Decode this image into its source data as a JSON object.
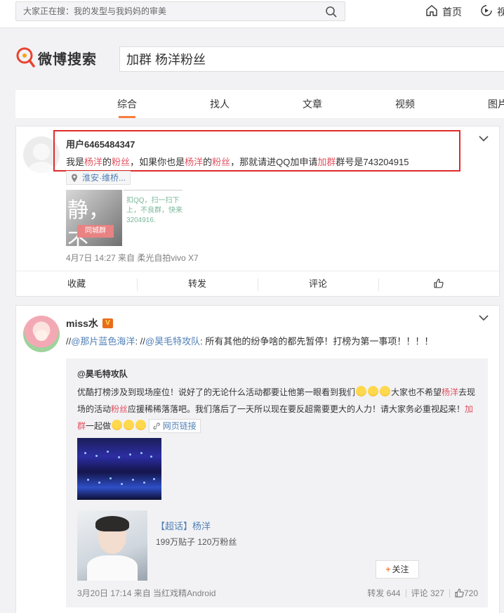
{
  "topbar": {
    "search_placeholder": "大家正在搜：我的发型与我妈妈的审美",
    "nav_home": "首页",
    "nav_video": "视"
  },
  "header": {
    "logo_text": "微博搜索",
    "query": "加群 杨洋粉丝"
  },
  "tabs": [
    {
      "label": "综合",
      "active": true
    },
    {
      "label": "找人",
      "active": false
    },
    {
      "label": "文章",
      "active": false
    },
    {
      "label": "视频",
      "active": false
    },
    {
      "label": "图片",
      "active": false
    }
  ],
  "post1": {
    "username": "用户6465484347",
    "text": {
      "p1": "我是",
      "h1": "杨洋",
      "p2": "的",
      "h2": "粉丝",
      "p3": "，如果你也是",
      "h3": "杨洋",
      "p4": "的",
      "h4": "粉丝",
      "p5": "，那就请进QQ加申请",
      "h5": "加群",
      "p6": "群号是743204915"
    },
    "location": "淮安·维桥...",
    "img1_big": "静，不",
    "img1_badge": "同城群",
    "img2_text": "扣QQ，扫一扫下上，不良群，快来3204916.",
    "meta": "4月7日 14:27 来自 柔光自拍vivo X7",
    "actions": {
      "favorite": "收藏",
      "repost": "转发",
      "comment": "评论"
    }
  },
  "post2": {
    "username": "miss水",
    "vbadge": "V",
    "text": {
      "prefix": "//",
      "mention1": "@那片蓝色海洋",
      "sep": ": //",
      "mention2": "@昊毛特攻队",
      "rest": ": 所有其他的纷争啥的都先暂停！打榜为第一事项！！！！"
    },
    "repost": {
      "author": "@昊毛特攻队",
      "t1": "优酷打榜涉及到现场座位！说好了的无论什么活动都要让他第一眼看到我们",
      "t2": "大家也不希望",
      "h1": "杨洋",
      "t3": "去现场的活动",
      "h2": "粉丝",
      "t4": "应援稀稀落落吧。我们落后了一天所以现在要反超需要更大的人力！请大家务必重视起来！",
      "h3": "加群",
      "t5": "一起做",
      "web_link": "网页链接",
      "topic_title": "【超话】杨洋",
      "topic_sub": "199万贴子 120万粉丝",
      "follow": "关注",
      "meta": "3月20日 17:14 来自 当红戏精Android",
      "reposts": "转发 644",
      "comments": "评论 327",
      "likes": "720"
    }
  }
}
